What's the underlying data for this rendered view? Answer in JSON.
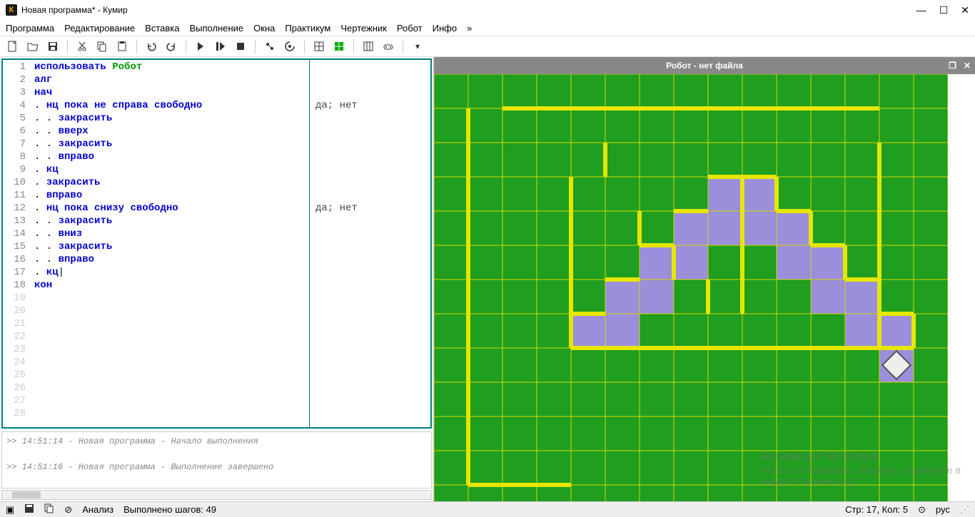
{
  "app": {
    "icon_letter": "К",
    "title": "Новая программа* - Кумир"
  },
  "menu": [
    "Программа",
    "Редактирование",
    "Вставка",
    "Выполнение",
    "Окна",
    "Практикум",
    "Чертежник",
    "Робот",
    "Инфо",
    "»"
  ],
  "editor": {
    "max_line": 28,
    "lines": [
      {
        "n": 1,
        "html": "<span class='kw'>использовать</span> <span class='kwg'>Робот</span>"
      },
      {
        "n": 2,
        "html": "<span class='kw'>алг</span>"
      },
      {
        "n": 3,
        "html": "<span class='kw'>нач</span>"
      },
      {
        "n": 4,
        "html": ". <span class='kw'>нц пока не</span> <span class='kw'>справа свободно</span>",
        "side": "да; нет"
      },
      {
        "n": 5,
        "html": ". . <span class='kw'>закрасить</span>"
      },
      {
        "n": 6,
        "html": ". . <span class='kw'>вверх</span>"
      },
      {
        "n": 7,
        "html": ". . <span class='kw'>закрасить</span>"
      },
      {
        "n": 8,
        "html": ". . <span class='kw'>вправо</span>"
      },
      {
        "n": 9,
        "html": ". <span class='kw'>кц</span>"
      },
      {
        "n": 10,
        "html": ". <span class='kw'>закрасить</span>"
      },
      {
        "n": 11,
        "html": ". <span class='kw'>вправо</span>"
      },
      {
        "n": 12,
        "html": ". <span class='kw'>нц пока</span> <span class='kw'>снизу свободно</span>",
        "side": "да; нет"
      },
      {
        "n": 13,
        "html": ". . <span class='kw'>закрасить</span>"
      },
      {
        "n": 14,
        "html": ". . <span class='kw'>вниз</span>"
      },
      {
        "n": 15,
        "html": ". . <span class='kw'>закрасить</span>"
      },
      {
        "n": 16,
        "html": ". . <span class='kw'>вправо</span>"
      },
      {
        "n": 17,
        "html": ". <span class='kw'>кц</span>|"
      },
      {
        "n": 18,
        "html": "<span class='kw'>кон</span>"
      }
    ]
  },
  "console": [
    ">> 14:51:14 - Новая программа - Начало выполнения",
    "",
    ">> 14:51:16 - Новая программа - Выполнение завершено"
  ],
  "robot_panel": {
    "title": "Робот - нет файла"
  },
  "status": {
    "analysis": "Анализ",
    "steps_label": "Выполнено шагов: 49",
    "cursor": "Стр: 17, Кол: 5",
    "lang": "рус"
  },
  "watermark": {
    "l1": "Активация Windows",
    "l2": "Чтобы активировать Windows, перейдите в",
    "l3": "раздел \"Параметры\"."
  },
  "robot_grid": {
    "cols": 15,
    "rows": 13,
    "cell": 48,
    "painted": [
      [
        4,
        7
      ],
      [
        5,
        7
      ],
      [
        5,
        6
      ],
      [
        6,
        6
      ],
      [
        6,
        5
      ],
      [
        7,
        5
      ],
      [
        7,
        4
      ],
      [
        8,
        4
      ],
      [
        8,
        3
      ],
      [
        9,
        3
      ],
      [
        9,
        4
      ],
      [
        10,
        4
      ],
      [
        10,
        5
      ],
      [
        11,
        5
      ],
      [
        11,
        6
      ],
      [
        12,
        6
      ],
      [
        12,
        7
      ],
      [
        13,
        7
      ],
      [
        13,
        8
      ]
    ],
    "walls_h": [
      [
        1,
        2,
        13
      ],
      [
        12,
        1,
        4
      ],
      [
        8,
        4,
        13
      ],
      [
        3,
        8,
        9
      ],
      [
        4,
        7,
        8
      ],
      [
        5,
        6,
        7
      ],
      [
        6,
        5,
        6
      ],
      [
        7,
        4,
        5
      ],
      [
        3,
        9,
        10
      ],
      [
        4,
        10,
        11
      ],
      [
        5,
        11,
        12
      ],
      [
        6,
        12,
        13
      ],
      [
        7,
        13,
        14
      ],
      [
        8,
        13,
        14
      ]
    ],
    "walls_v": [
      [
        1,
        1,
        12
      ],
      [
        4,
        3,
        8
      ],
      [
        5,
        2,
        3
      ],
      [
        6,
        4,
        5
      ],
      [
        7,
        5,
        6
      ],
      [
        8,
        6,
        7
      ],
      [
        9,
        3,
        7
      ],
      [
        10,
        3,
        4
      ],
      [
        11,
        4,
        5
      ],
      [
        12,
        5,
        6
      ],
      [
        13,
        2,
        8
      ],
      [
        14,
        7,
        8
      ]
    ],
    "robot": [
      13,
      8
    ]
  }
}
